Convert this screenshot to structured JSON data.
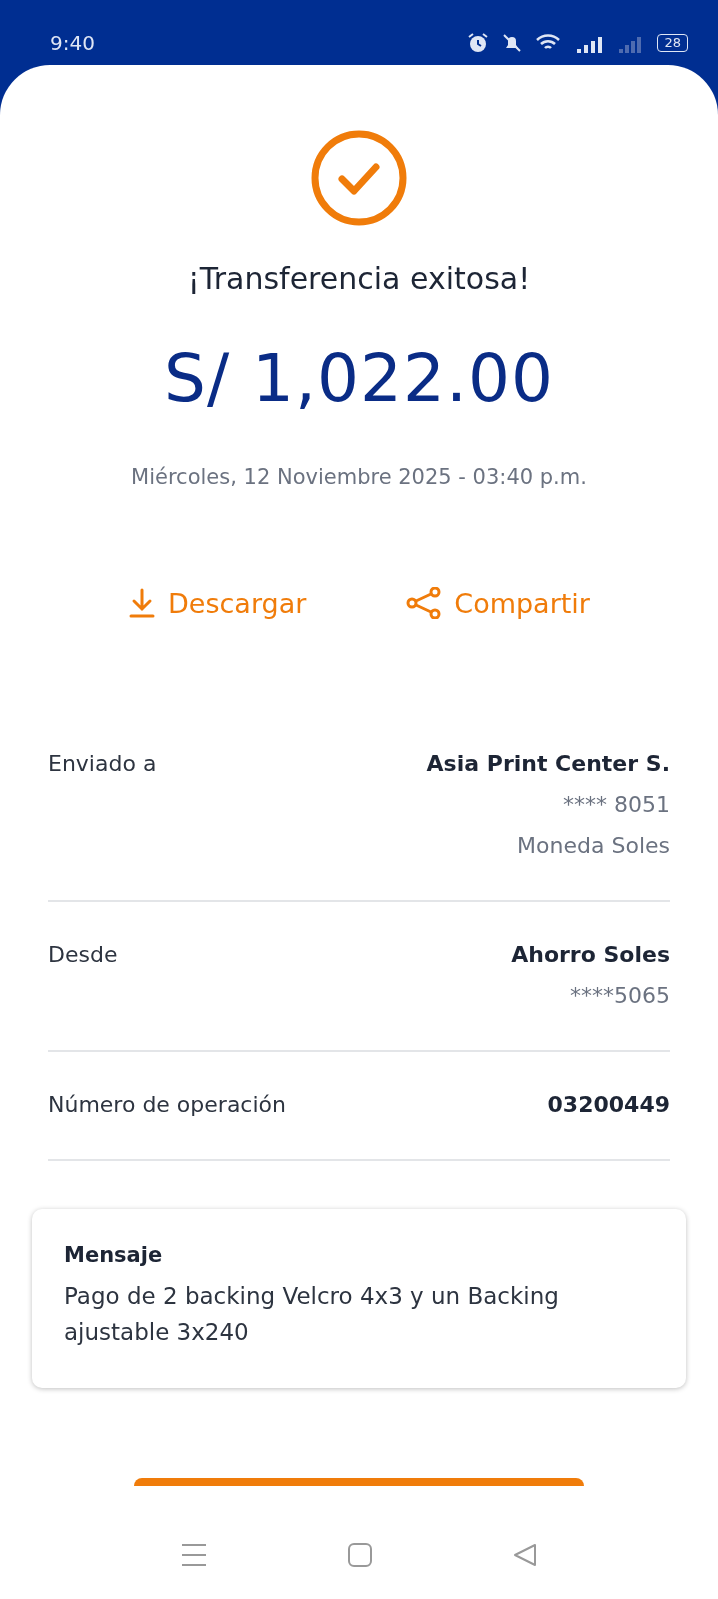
{
  "status_bar": {
    "time": "9:40",
    "battery": "28"
  },
  "result": {
    "title": "¡Transferencia exitosa!",
    "amount": "S/ 1,022.00",
    "date": "Miércoles, 12 Noviembre 2025 - 03:40 p.m."
  },
  "actions": [
    {
      "kind": "download",
      "label": "Descargar"
    },
    {
      "kind": "share",
      "label": "Compartir"
    }
  ],
  "details": [
    {
      "label": "Enviado a",
      "values": [
        {
          "text": "Asia Print Center S.",
          "bold": true
        },
        {
          "text": "**** 8051",
          "bold": false
        },
        {
          "text": "Moneda Soles",
          "bold": false
        }
      ]
    },
    {
      "label": "Desde",
      "values": [
        {
          "text": "Ahorro Soles",
          "bold": true
        },
        {
          "text": "****5065",
          "bold": false
        }
      ]
    },
    {
      "label": "Número de operación",
      "values": [
        {
          "text": "03200449",
          "bold": true
        }
      ]
    }
  ],
  "message": {
    "title": "Mensaje",
    "text": "Pago de 2 backing Velcro 4x3 y un Backing ajustable 3x240"
  }
}
